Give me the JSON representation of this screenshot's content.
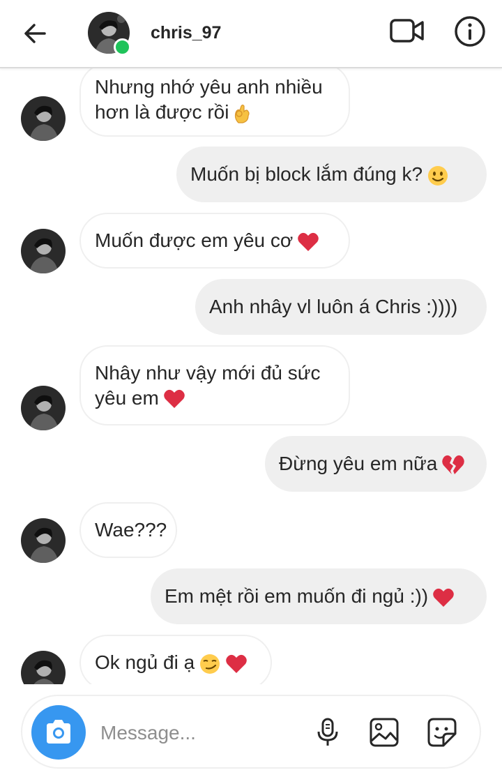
{
  "header": {
    "username": "chris_97",
    "online": true
  },
  "messages": [
    {
      "side": "in",
      "text": "Nhưng nhớ yêu anh nhiều\nhơn là được rồi",
      "emoji": "ok-hand"
    },
    {
      "side": "out",
      "text": "Muốn bị block lắm đúng k?",
      "emoji": "slight-smile"
    },
    {
      "side": "in",
      "text": "Muốn được em yêu cơ",
      "emoji": "red-heart"
    },
    {
      "side": "out",
      "text": "Anh nhây vl luôn á Chris :))))",
      "emoji": ""
    },
    {
      "side": "in",
      "text": "Nhây như vậy mới đủ sức\nyêu em",
      "emoji": "red-heart"
    },
    {
      "side": "out",
      "text": "Đừng yêu em nữa",
      "emoji": "broken-heart"
    },
    {
      "side": "in",
      "text": "Wae???",
      "emoji": ""
    },
    {
      "side": "out",
      "text": "Em mệt rồi em muốn đi ngủ :))",
      "emoji": "red-heart"
    },
    {
      "side": "in",
      "text": "Ok ngủ đi ạ",
      "emoji": "smirk red-heart"
    }
  ],
  "composer": {
    "placeholder": "Message..."
  },
  "icons": [
    "back-arrow-icon",
    "video-call-icon",
    "info-icon",
    "camera-icon",
    "microphone-icon",
    "gallery-icon",
    "sticker-icon"
  ],
  "colors": {
    "accent": "#3797f0",
    "online": "#1fc35a",
    "outgoing_bubble": "#efefef",
    "incoming_border": "#efefef"
  }
}
